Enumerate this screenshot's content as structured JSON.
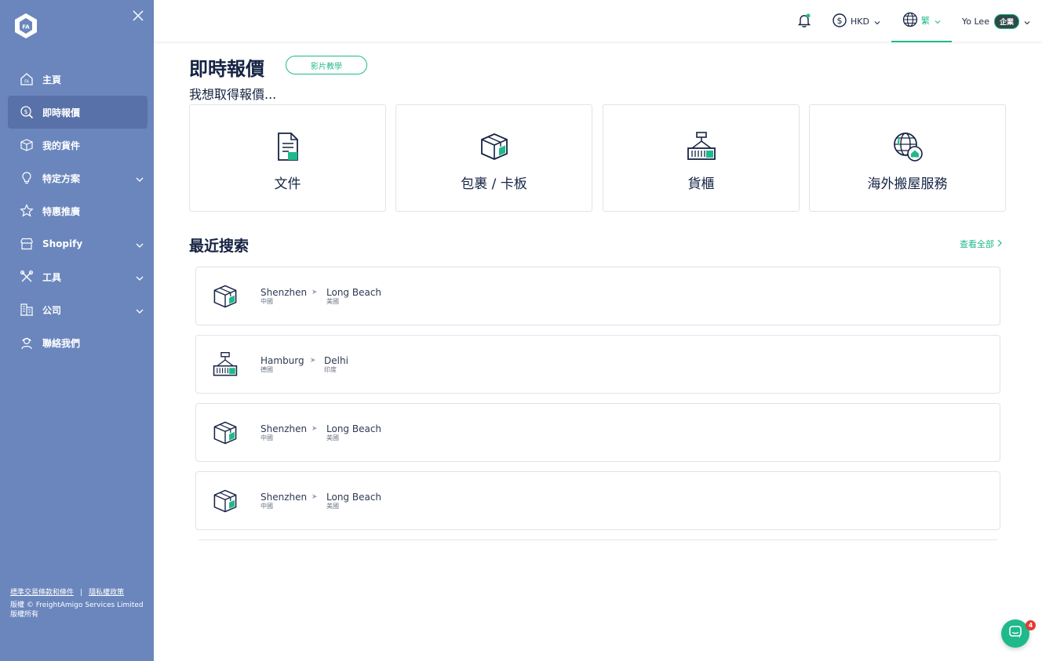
{
  "sidebar": {
    "logo_icon": "freightamigo-logo-icon",
    "close_icon": "close-icon",
    "items": [
      {
        "label": "主頁",
        "icon": "home-icon",
        "active": false,
        "has_submenu": false
      },
      {
        "label": "即時報價",
        "icon": "dollar-search-icon",
        "active": true,
        "has_submenu": false
      },
      {
        "label": "我的貨件",
        "icon": "box-icon",
        "active": false,
        "has_submenu": false
      },
      {
        "label": "特定方案",
        "icon": "lightbulb-icon",
        "active": false,
        "has_submenu": true
      },
      {
        "label": "特惠推廣",
        "icon": "star-icon",
        "active": false,
        "has_submenu": false
      },
      {
        "label": "Shopify",
        "icon": "store-icon",
        "active": false,
        "has_submenu": true
      },
      {
        "label": "工具",
        "icon": "tools-icon",
        "active": false,
        "has_submenu": true
      },
      {
        "label": "公司",
        "icon": "building-icon",
        "active": false,
        "has_submenu": true
      },
      {
        "label": "聯絡我們",
        "icon": "support-agent-icon",
        "active": false,
        "has_submenu": false
      }
    ],
    "footer": {
      "terms_link": "標準交易條款和條件",
      "separator": "|",
      "privacy_link": "隱私權政策",
      "copyright": "版權 © FreightAmigo Services Limited",
      "rights": "版權所有"
    }
  },
  "topbar": {
    "notification_icon": "bell-icon",
    "currency": "HKD",
    "language": "繁",
    "user_name": "Yo Lee",
    "user_badge": "企業"
  },
  "main": {
    "title": "即時報價",
    "video_button": "影片教學",
    "subtitle": "我想取得報價...",
    "quote_types": [
      {
        "label": "文件",
        "icon": "document-icon"
      },
      {
        "label": "包裹 / 卡板",
        "icon": "parcel-icon"
      },
      {
        "label": "貨櫃",
        "icon": "container-icon"
      },
      {
        "label": "海外搬屋服務",
        "icon": "globe-home-icon"
      }
    ],
    "recent_title": "最近搜索",
    "see_all": "查看全部",
    "recent_searches": [
      {
        "type_icon": "parcel-icon",
        "origin_city": "Shenzhen",
        "origin_country": "中國",
        "dest_city": "Long Beach",
        "dest_country": "美國"
      },
      {
        "type_icon": "container-icon",
        "origin_city": "Hamburg",
        "origin_country": "德國",
        "dest_city": "Delhi",
        "dest_country": "印度"
      },
      {
        "type_icon": "parcel-icon",
        "origin_city": "Shenzhen",
        "origin_country": "中國",
        "dest_city": "Long Beach",
        "dest_country": "美國"
      },
      {
        "type_icon": "parcel-icon",
        "origin_city": "Shenzhen",
        "origin_country": "中國",
        "dest_city": "Long Beach",
        "dest_country": "美國"
      }
    ]
  },
  "chat": {
    "icon": "chat-icon",
    "badge": "4"
  },
  "colors": {
    "sidebar": "#6a86bd",
    "accent": "#1fb98b",
    "navy": "#152343"
  }
}
